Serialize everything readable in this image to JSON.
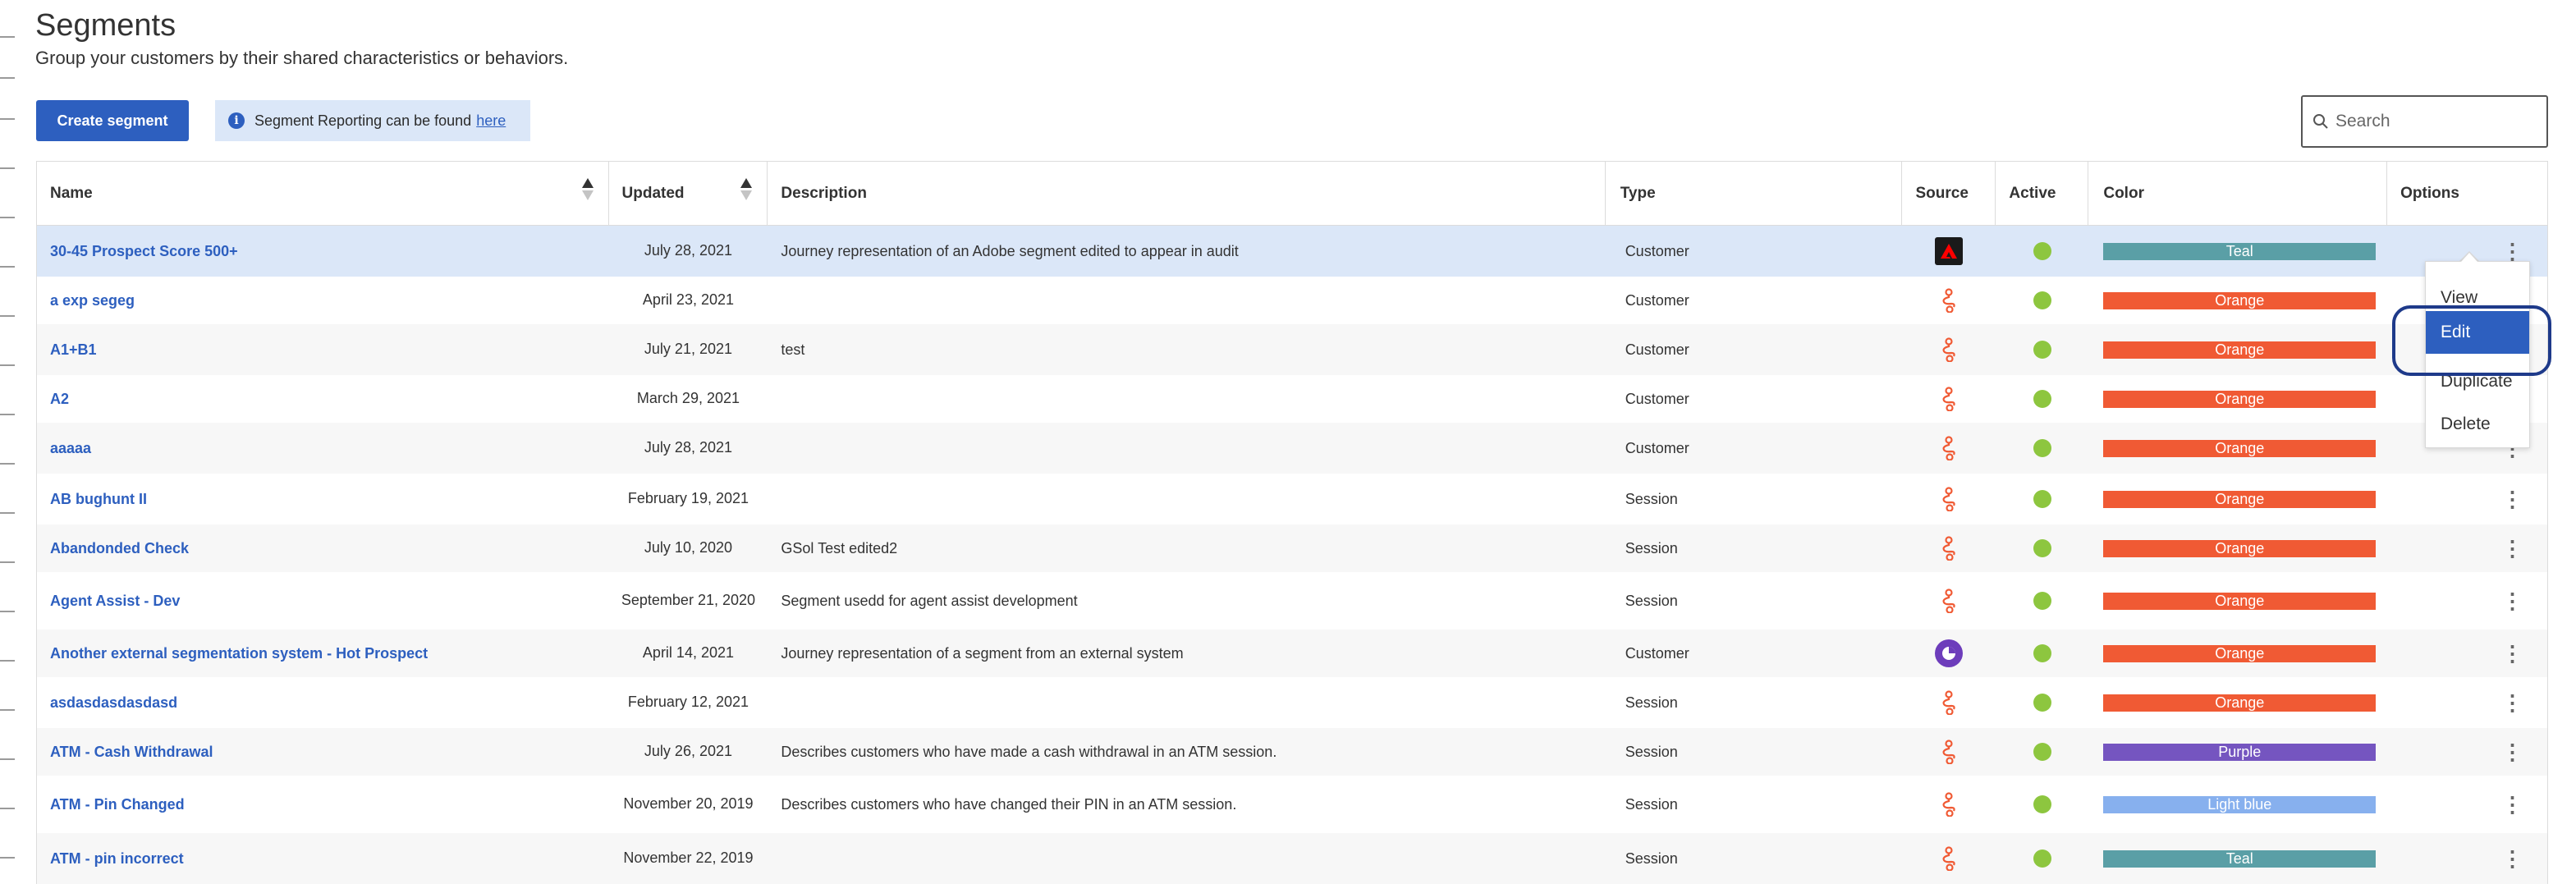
{
  "header": {
    "title": "Segments",
    "subtitle": "Group your customers by their shared characteristics or behaviors."
  },
  "toolbar": {
    "create_label": "Create segment",
    "info_text": "Segment Reporting can be found",
    "info_link": "here",
    "search_placeholder": "Search"
  },
  "table": {
    "columns": [
      "Name",
      "Updated",
      "Description",
      "Type",
      "Source",
      "Active",
      "Color",
      "Options"
    ],
    "rows": [
      {
        "name": "30-45 Prospect Score 500+",
        "updated": "July 28, 2021",
        "description": "Journey representation of an Adobe segment edited to appear in audit",
        "type": "Customer",
        "source": "adobe-icon",
        "color_label": "Teal",
        "color": "#5a9fa6"
      },
      {
        "name": "a exp segeg",
        "updated": "April 23, 2021",
        "description": "",
        "type": "Customer",
        "source": "journey-icon",
        "color_label": "Orange",
        "color": "#f05a34"
      },
      {
        "name": "A1+B1",
        "updated": "July 21, 2021",
        "description": "test",
        "type": "Customer",
        "source": "journey-icon",
        "color_label": "Orange",
        "color": "#f05a34"
      },
      {
        "name": "A2",
        "updated": "March 29, 2021",
        "description": "",
        "type": "Customer",
        "source": "journey-icon",
        "color_label": "Orange",
        "color": "#f05a34"
      },
      {
        "name": "aaaaa",
        "updated": "July 28, 2021",
        "description": "",
        "type": "Customer",
        "source": "journey-icon",
        "color_label": "Orange",
        "color": "#f05a34"
      },
      {
        "name": "AB bughunt II",
        "updated": "February 19, 2021",
        "description": "",
        "type": "Session",
        "source": "journey-icon",
        "color_label": "Orange",
        "color": "#f05a34"
      },
      {
        "name": "Abandonded Check",
        "updated": "July 10, 2020",
        "description": "GSol Test edited2",
        "type": "Session",
        "source": "journey-icon",
        "color_label": "Orange",
        "color": "#f05a34"
      },
      {
        "name": "Agent Assist - Dev",
        "updated": "September 21, 2020",
        "description": "Segment usedd for agent assist development",
        "type": "Session",
        "source": "journey-icon",
        "color_label": "Orange",
        "color": "#f05a34"
      },
      {
        "name": "Another external segmentation system - Hot Prospect",
        "updated": "April 14, 2021",
        "description": "Journey representation of a segment from an external system",
        "type": "Customer",
        "source": "external-icon",
        "color_label": "Orange",
        "color": "#f05a34"
      },
      {
        "name": "asdasdasdasdasd",
        "updated": "February 12, 2021",
        "description": "",
        "type": "Session",
        "source": "journey-icon",
        "color_label": "Orange",
        "color": "#f05a34"
      },
      {
        "name": "ATM - Cash Withdrawal",
        "updated": "July 26, 2021",
        "description": "Describes customers who have made a cash withdrawal in an ATM session.",
        "type": "Session",
        "source": "journey-icon",
        "color_label": "Purple",
        "color": "#7555c0"
      },
      {
        "name": "ATM - Pin Changed",
        "updated": "November 20, 2019",
        "description": "Describes customers who have changed their PIN in an ATM session.",
        "type": "Session",
        "source": "journey-icon",
        "color_label": "Light blue",
        "color": "#87b0ee"
      },
      {
        "name": "ATM - pin incorrect",
        "updated": "November 22, 2019",
        "description": "",
        "type": "Session",
        "source": "journey-icon",
        "color_label": "Teal",
        "color": "#5a9fa6"
      }
    ]
  },
  "menu": {
    "items": [
      "View",
      "Edit",
      "Duplicate",
      "Delete"
    ]
  },
  "colors": {
    "primary": "#2d5fbf",
    "active": "#8dc63f"
  }
}
